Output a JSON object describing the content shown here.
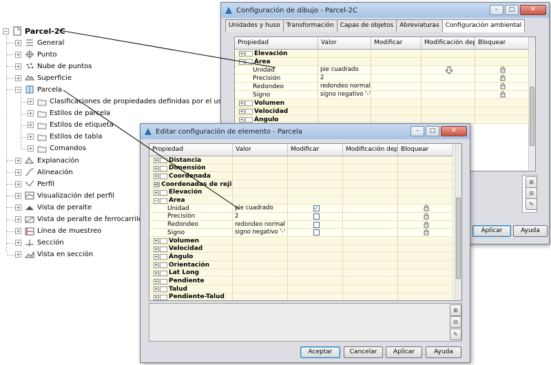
{
  "tree": {
    "root_label": "Parcel-2C",
    "items": [
      {
        "label": "General",
        "icon": "general-icon"
      },
      {
        "label": "Punto",
        "icon": "point-icon"
      },
      {
        "label": "Nube de puntos",
        "icon": "point-cloud-icon"
      },
      {
        "label": "Superficie",
        "icon": "surface-icon"
      },
      {
        "label": "Parcela",
        "icon": "parcel-icon"
      },
      {
        "label": "Clasificaciones de propiedades definidas por el usuario",
        "icon": "folder-icon"
      },
      {
        "label": "Estilos de parcela",
        "icon": "folder-icon"
      },
      {
        "label": "Estilos de etiqueta",
        "icon": "folder-icon"
      },
      {
        "label": "Estilos de tabla",
        "icon": "folder-icon"
      },
      {
        "label": "Comandos",
        "icon": "folder-icon"
      },
      {
        "label": "Explanación",
        "icon": "grading-icon"
      },
      {
        "label": "Alineación",
        "icon": "alignment-icon"
      },
      {
        "label": "Perfil",
        "icon": "profile-icon"
      },
      {
        "label": "Visualización del perfil",
        "icon": "profile-view-icon"
      },
      {
        "label": "Vista de peralte",
        "icon": "superelevation-view-icon"
      },
      {
        "label": "Vista de peralte de ferrocarriles",
        "icon": "rail-superelevation-icon"
      },
      {
        "label": "Línea de muestreo",
        "icon": "sample-line-icon"
      },
      {
        "label": "Sección",
        "icon": "section-icon"
      },
      {
        "label": "Vista en sección",
        "icon": "section-view-icon"
      }
    ]
  },
  "dialog1": {
    "title": "Configuración de dibujo - Parcel-2C",
    "window_buttons": [
      "–",
      "□",
      "✕"
    ],
    "tabs": [
      "Unidades y huso",
      "Transformación",
      "Capas de objetos",
      "Abreviaturas",
      "Configuración ambiental"
    ],
    "columns": [
      "Propiedad",
      "Valor",
      "Modificar",
      "Modificación dep...",
      "Bloquear"
    ],
    "rows": [
      {
        "name": "Elevación",
        "type": "group",
        "expander": "+"
      },
      {
        "name": "Área",
        "type": "group",
        "expander": "−"
      },
      {
        "name": "Unidad",
        "type": "leaf",
        "value": "pie cuadrado",
        "override_icon": "down-arrow-icon",
        "lock": true
      },
      {
        "name": "Precisión",
        "type": "leaf",
        "value": "2",
        "lock": true
      },
      {
        "name": "Redondeo",
        "type": "leaf",
        "value": "redondeo normal",
        "lock": true
      },
      {
        "name": "Signo",
        "type": "leaf",
        "value": "signo negativo '-'",
        "lock": true
      },
      {
        "name": "Volumen",
        "type": "group",
        "expander": "+"
      },
      {
        "name": "Velocidad",
        "type": "group",
        "expander": "+"
      },
      {
        "name": "Ángulo",
        "type": "group",
        "expander": "+"
      }
    ],
    "buttons": {
      "apply": "Aplicar",
      "help": "Ayuda"
    }
  },
  "dialog2": {
    "title": "Editar configuración de elemento - Parcela",
    "window_buttons": [
      "–",
      "□",
      "✕"
    ],
    "columns": [
      "Propiedad",
      "Valor",
      "Modificar",
      "Modificación depe...",
      "Bloquear"
    ],
    "rows": [
      {
        "name": "Distancia",
        "type": "group",
        "expander": "+"
      },
      {
        "name": "Dimensión",
        "type": "group",
        "expander": "+"
      },
      {
        "name": "Coordenada",
        "type": "group",
        "expander": "+"
      },
      {
        "name": "Coordenadas de rejilla",
        "type": "group",
        "expander": "+"
      },
      {
        "name": "Elevación",
        "type": "group",
        "expander": "+"
      },
      {
        "name": "Área",
        "type": "group",
        "expander": "−"
      },
      {
        "name": "Unidad",
        "type": "leaf",
        "value": "pie cuadrado",
        "checked": true,
        "lock": true
      },
      {
        "name": "Precisión",
        "type": "leaf",
        "value": "2",
        "checked": false,
        "lock": true
      },
      {
        "name": "Redondeo",
        "type": "leaf",
        "value": "redondeo normal",
        "checked": false,
        "lock": true
      },
      {
        "name": "Signo",
        "type": "leaf",
        "value": "signo negativo '-'",
        "checked": false,
        "lock": true
      },
      {
        "name": "Volumen",
        "type": "group",
        "expander": "+"
      },
      {
        "name": "Velocidad",
        "type": "group",
        "expander": "+"
      },
      {
        "name": "Ángulo",
        "type": "group",
        "expander": "+"
      },
      {
        "name": "Orientación",
        "type": "group",
        "expander": "+"
      },
      {
        "name": "Lat Long",
        "type": "group",
        "expander": "+"
      },
      {
        "name": "Pendiente",
        "type": "group",
        "expander": "+"
      },
      {
        "name": "Talud",
        "type": "group",
        "expander": "+"
      },
      {
        "name": "Pendiente-Talud",
        "type": "group",
        "expander": "+"
      }
    ],
    "buttons": {
      "ok": "Aceptar",
      "cancel": "Cancelar",
      "apply": "Aplicar",
      "help": "Ayuda"
    }
  },
  "colors": {
    "row_bg": "#fbf9e3",
    "title_bg": "#b7cfeb",
    "accent": "#3c7fb1"
  }
}
